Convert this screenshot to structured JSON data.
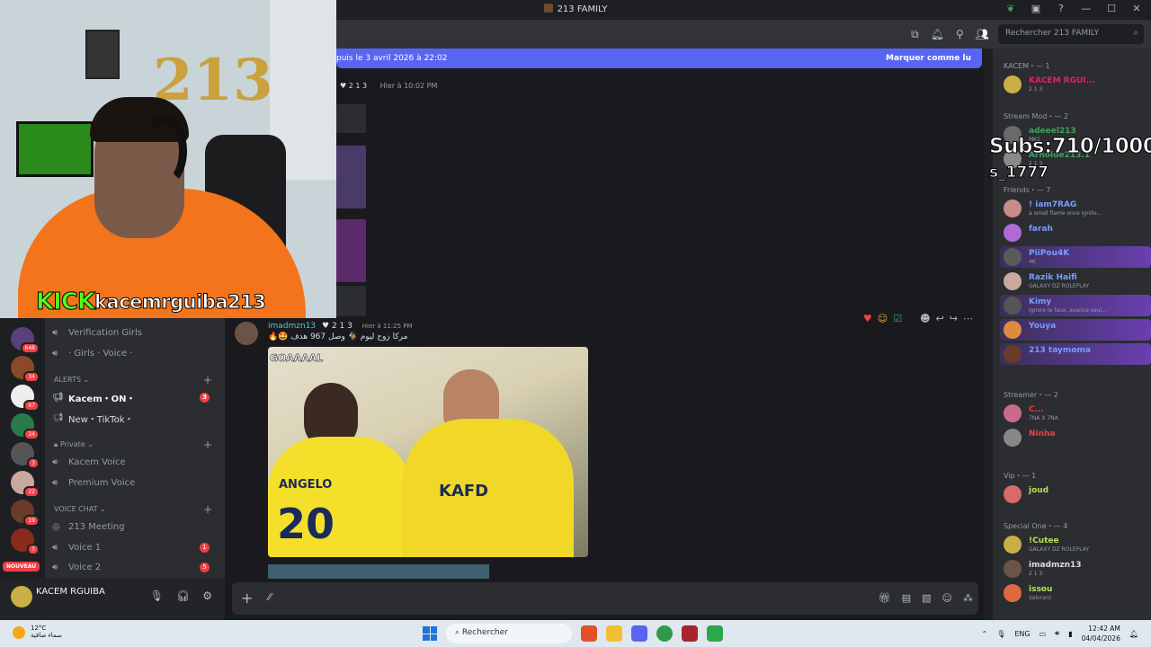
{
  "window": {
    "title": "213 FAMILY"
  },
  "header": {
    "search_placeholder": "Rechercher 213 FAMILY"
  },
  "new_messages": {
    "since": "puis le 3 avril 2026 à 22:02",
    "mark_read": "Marquer comme lu"
  },
  "top_message": {
    "tag": "2 1 3",
    "time": "Hier à 10:02 PM"
  },
  "stream": {
    "platform": "KICK",
    "username": "kacemrguiba213",
    "balloon": "213",
    "subs": "Subs:710/1000",
    "ticker": "s_1777"
  },
  "channels": {
    "items": [
      {
        "label": "Verification Girls"
      },
      {
        "label": "· Girls · Voice ·"
      }
    ],
    "alerts_cat": "ALERTS",
    "alerts": [
      {
        "label": "Kacem・ON・",
        "badge": "3"
      },
      {
        "label": "New・TikTok・"
      }
    ],
    "private_cat": "Private",
    "private": [
      {
        "label": "Kacem Voice"
      },
      {
        "label": "Premium Voice"
      }
    ],
    "voice_cat": "VOICE CHAT",
    "voice": [
      {
        "label": "213 Meeting"
      },
      {
        "label": "Voice 1",
        "badge": "1"
      },
      {
        "label": "Voice 2",
        "badge": "5"
      }
    ]
  },
  "servers": [
    {
      "badge": "648"
    },
    {
      "badge": "34"
    },
    {
      "badge": "67"
    },
    {
      "badge": "24"
    },
    {
      "badge": "3"
    },
    {
      "badge": "22"
    },
    {
      "badge": "19"
    },
    {
      "badge": "3"
    }
  ],
  "nouveau": "NOUVEAU",
  "user": {
    "name": "KACEM RGUIBA"
  },
  "message": {
    "author": "imadmzn13",
    "tag": "2 1 3",
    "time": "Hier à 11:25 PM",
    "text": "مركا زوج ليوم 🐐 وصل 967 هدف",
    "gif": {
      "tag": "GOAAAAL",
      "name": "ANGELO",
      "number": "20",
      "sponsor": "KAFD"
    }
  },
  "members": {
    "groups": [
      {
        "label": "KACEM・— 1",
        "members": [
          {
            "name": "KACEM RGUI...",
            "sub": "2 1 3",
            "color": "#e0245e"
          }
        ]
      },
      {
        "label": "Stream Mod・— 2",
        "members": [
          {
            "name": "adeeel213",
            "sub": "MK2",
            "color": "#3ba55c"
          },
          {
            "name": "Arnolde213.1",
            "sub": "2 1 3",
            "color": "#3ba55c"
          }
        ]
      },
      {
        "label": "Friends・— 7",
        "members": [
          {
            "name": "! iam7RAG",
            "sub": "a small flame once ignite...",
            "color": "#7a9cff"
          },
          {
            "name": "farah",
            "sub": "",
            "color": "#7a9cff"
          },
          {
            "name": "PiiPou4K",
            "sub": "4K",
            "color": "#7a9cff"
          },
          {
            "name": "Razik Haifi",
            "sub": "GALAXY DZ ROLEPLAY",
            "color": "#7a9cff"
          },
          {
            "name": "Kimy",
            "sub": "Ignore le faux, avance seul...",
            "color": "#7a9cff"
          },
          {
            "name": "Youya",
            "sub": "",
            "color": "#7a9cff"
          },
          {
            "name": "213 taymoma",
            "sub": "",
            "color": "#7a9cff"
          }
        ]
      },
      {
        "label": "Streamer・— 2",
        "members": [
          {
            "name": "C...",
            "sub": "7NA X 7NA",
            "color": "#f23f43"
          },
          {
            "name": "Ninha",
            "sub": "",
            "color": "#f23f43"
          }
        ]
      },
      {
        "label": "Vip・— 1",
        "members": [
          {
            "name": "joud",
            "sub": "",
            "color": "#b5e05b"
          }
        ]
      },
      {
        "label": "Special One・— 4",
        "members": [
          {
            "name": "!Cutee",
            "sub": "GALAXY DZ ROLEPLAY",
            "color": "#b5e05b"
          },
          {
            "name": "imadmzn13",
            "sub": "2 1 3",
            "color": "#dbdee1"
          },
          {
            "name": "issou",
            "sub": "Valorant",
            "color": "#b5e05b"
          }
        ]
      }
    ]
  },
  "taskbar": {
    "temp": "12°C",
    "weather": "سماء صافية",
    "search": "Rechercher",
    "lang": "ENG",
    "time": "12:42 AM",
    "date": "04/04/2026"
  }
}
